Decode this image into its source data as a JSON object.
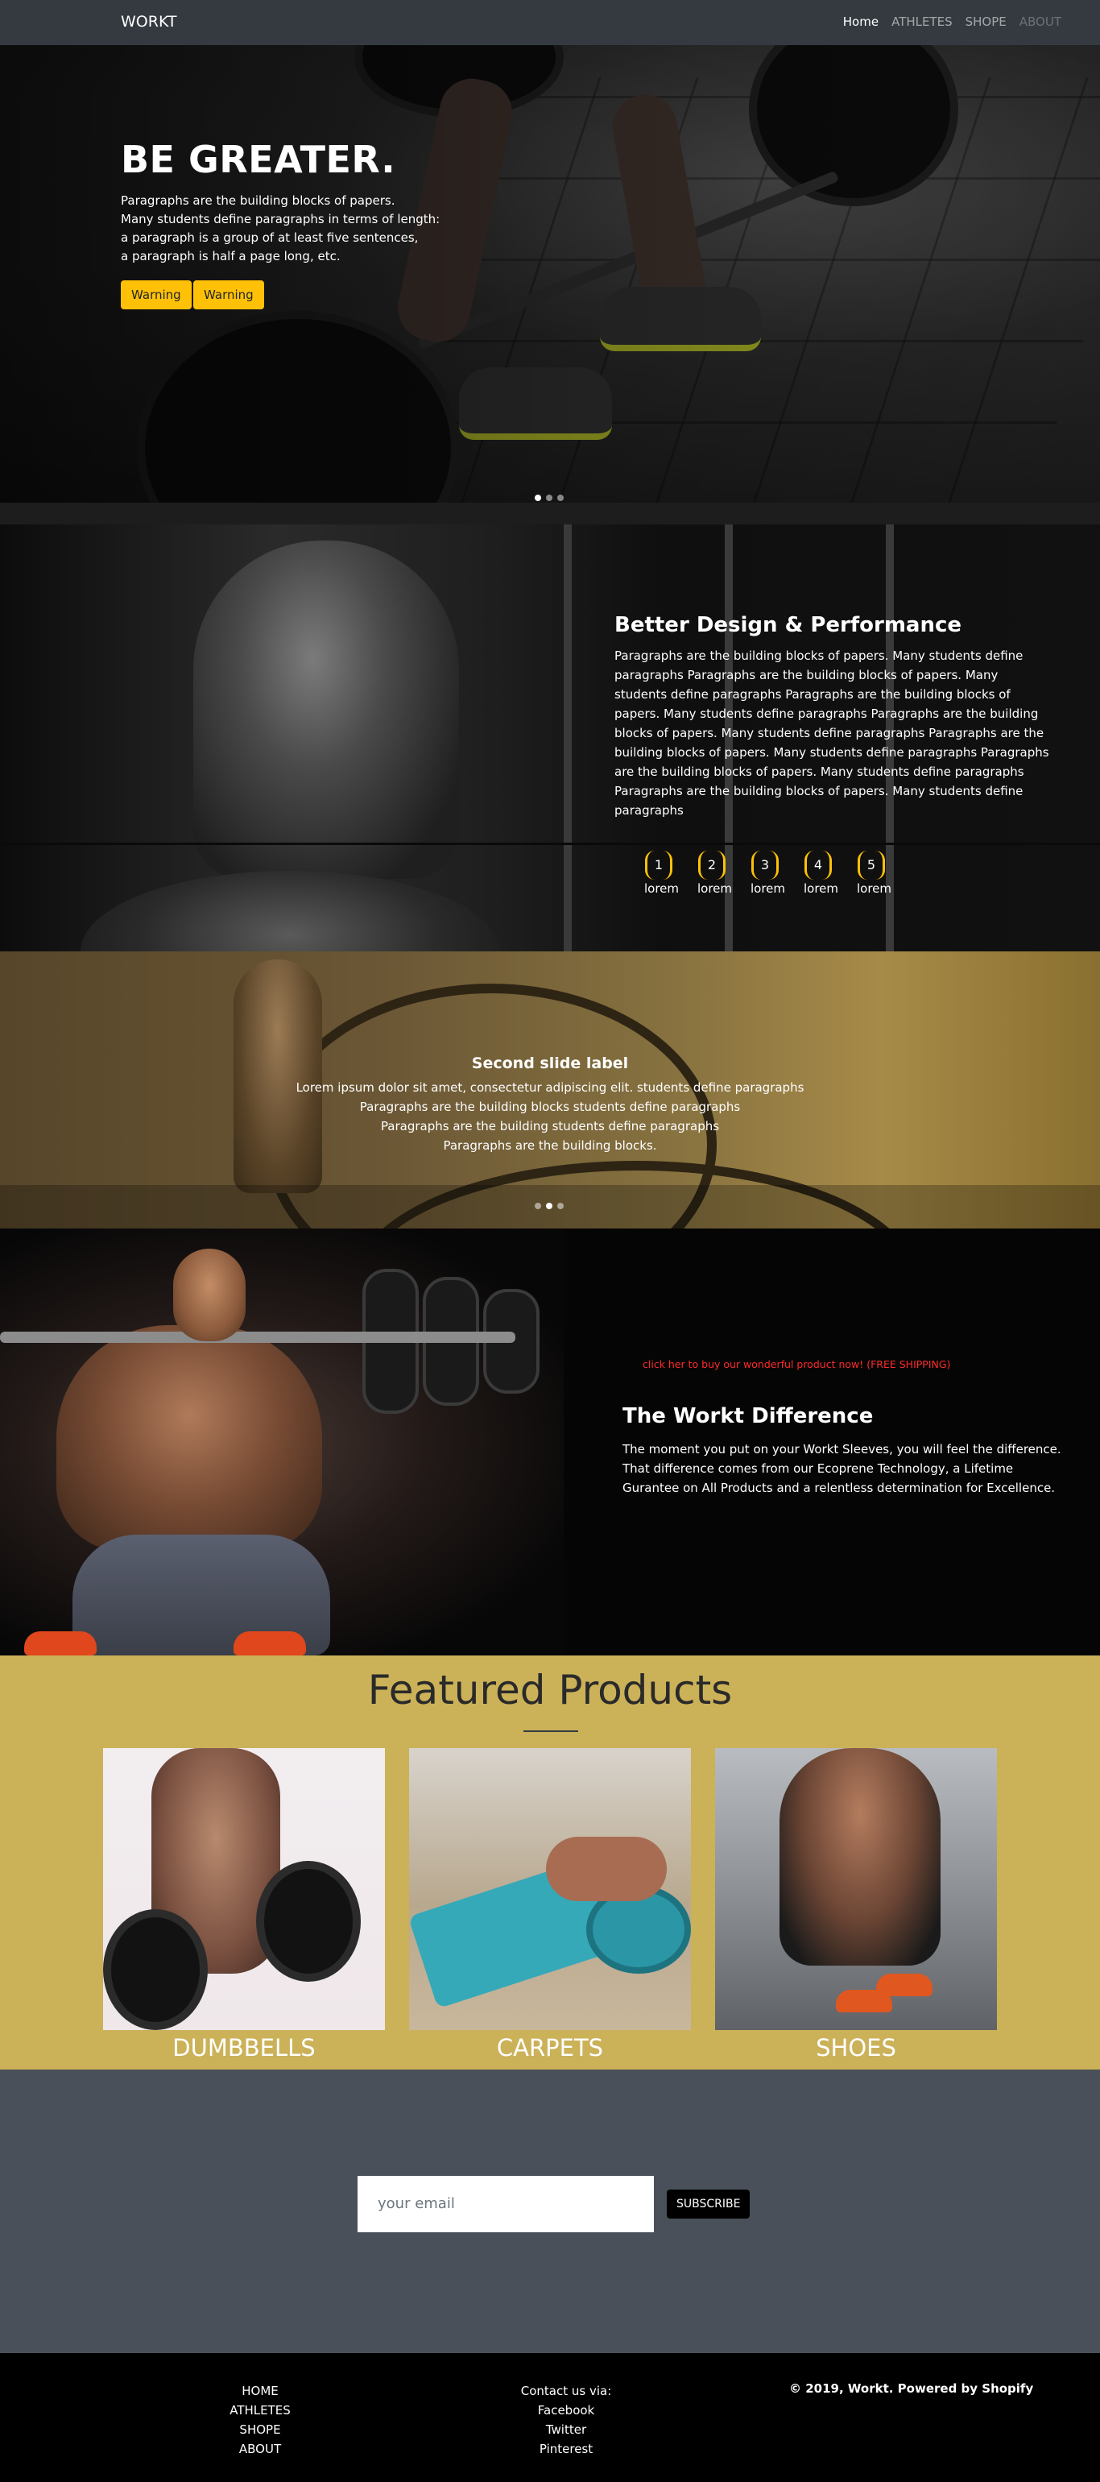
{
  "nav": {
    "brand": "WORKT",
    "links": [
      "Home",
      "ATHLETES",
      "SHOPE",
      "ABOUT"
    ]
  },
  "hero": {
    "title": "BE GREATER.",
    "lines": [
      "Paragraphs are the building blocks of papers.",
      "Many students define paragraphs in terms of length:",
      "a paragraph is a group of at least five sentences,",
      "a paragraph is half a page long, etc."
    ],
    "buttons": [
      "Warning",
      "Warning"
    ],
    "indicators": 3,
    "active_indicator": 0
  },
  "design": {
    "title": "Better Design & Performance",
    "text": "Paragraphs are the building blocks of papers. Many students define paragraphs Paragraphs are the building blocks of papers. Many students define paragraphs Paragraphs are the building blocks of papers. Many students define paragraphs Paragraphs are the building blocks of papers. Many students define paragraphs Paragraphs are the building blocks of papers. Many students define paragraphs Paragraphs are the building blocks of papers. Many students define paragraphs Paragraphs are the building blocks of papers. Many students define paragraphs",
    "steps": [
      {
        "num": "1",
        "label": "lorem"
      },
      {
        "num": "2",
        "label": "lorem"
      },
      {
        "num": "3",
        "label": "lorem"
      },
      {
        "num": "4",
        "label": "lorem"
      },
      {
        "num": "5",
        "label": "lorem"
      }
    ]
  },
  "slide2": {
    "title": "Second slide label",
    "lines": [
      "Lorem ipsum dolor sit amet, consectetur adipiscing elit. students define paragraphs",
      "Paragraphs are the building blocks students define paragraphs",
      "Paragraphs are the building students define paragraphs",
      "Paragraphs are the building blocks."
    ],
    "indicators": 3,
    "active_indicator": 1
  },
  "difference": {
    "promo": "click her to buy our wonderful product now! (FREE SHIPPING)",
    "title": "The Workt Difference",
    "text": "The moment you put on your Workt Sleeves, you will feel the difference. That difference comes from our Ecoprene Technology, a Lifetime Gurantee on All Products and a relentless determination for Excellence."
  },
  "featured": {
    "title": "Featured Products",
    "products": [
      {
        "name": "DUMBBELLS"
      },
      {
        "name": "CARPETS"
      },
      {
        "name": "SHOES"
      }
    ]
  },
  "subscribe": {
    "placeholder": "your email",
    "button": "SUBSCRIBE"
  },
  "footer": {
    "links": [
      "HOME",
      "ATHLETES",
      "SHOPE",
      "ABOUT"
    ],
    "contact_title": "Contact us via:",
    "contact": [
      "Facebook",
      "Twitter",
      "Pinterest"
    ],
    "copyright": "© 2019, Workt. Powered by Shopify"
  },
  "colors": {
    "nav_bg": "#343a40",
    "warning": "#ffc107",
    "featured_bg": "#cbb158",
    "subscribe_bg": "#4a5059",
    "promo": "#ff2a2a"
  }
}
